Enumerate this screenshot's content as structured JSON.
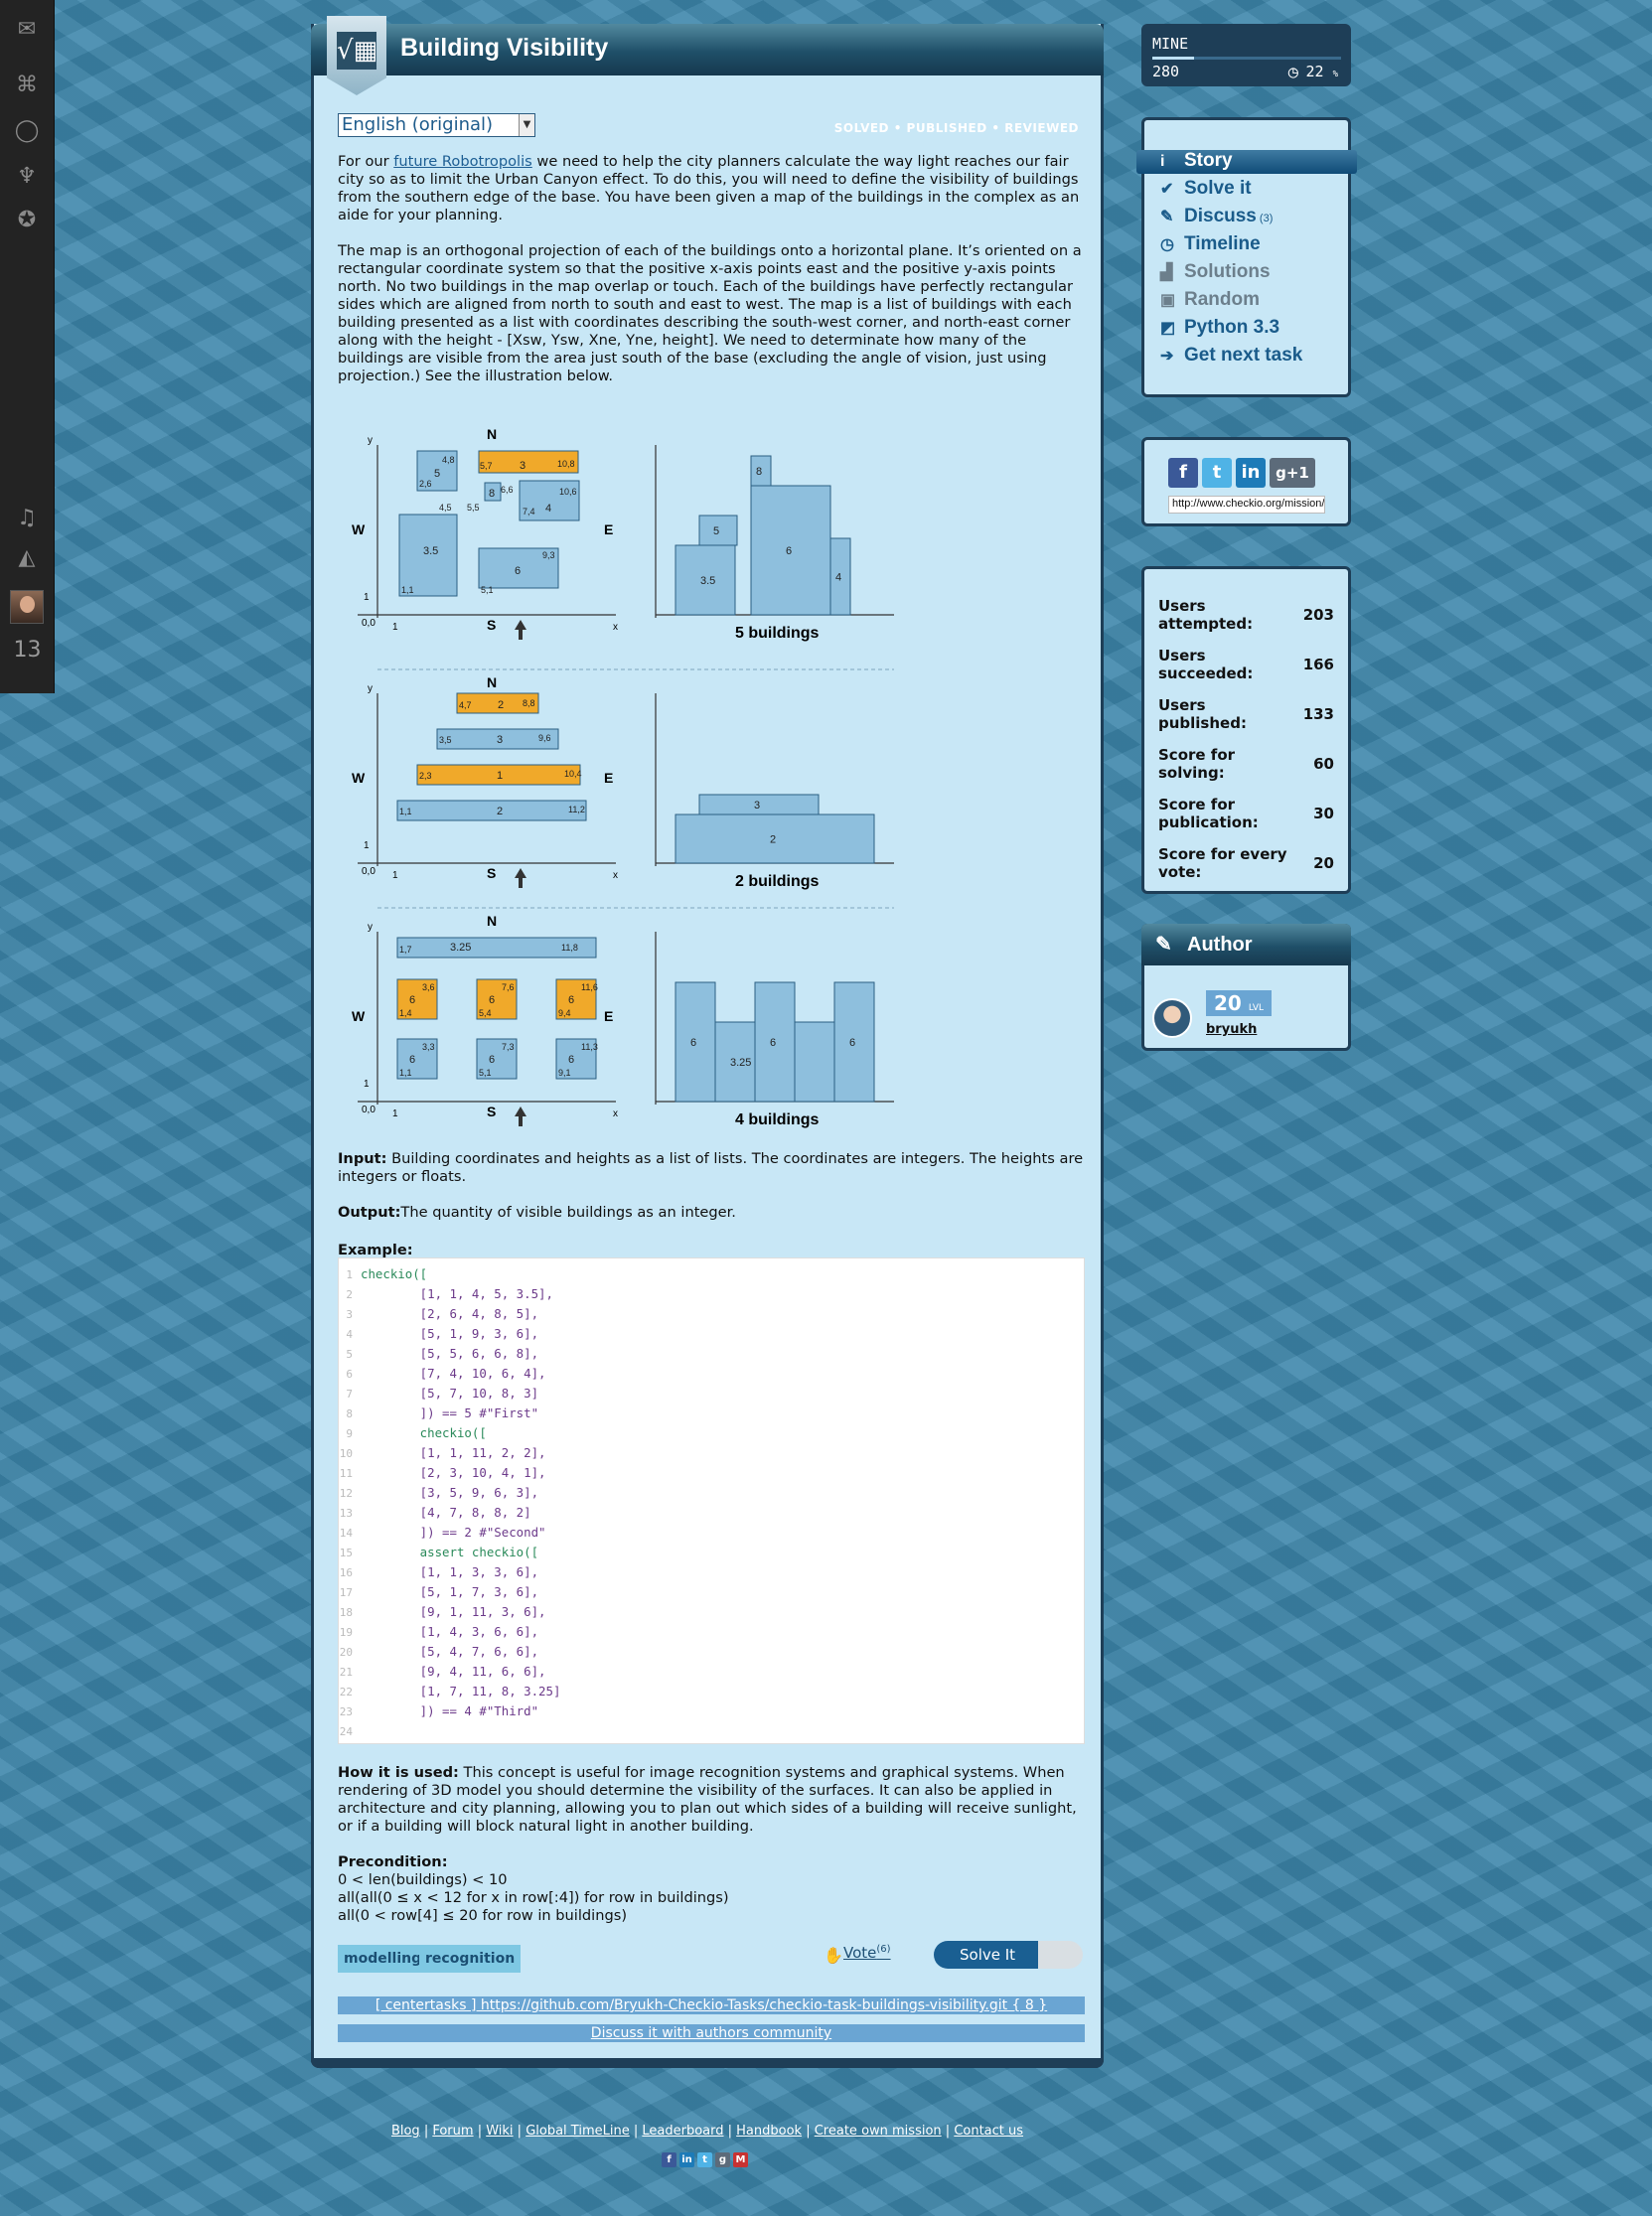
{
  "leftnav": {
    "count": "13"
  },
  "title": "Building Visibility",
  "language": "English (original)",
  "status_flags": "SOLVED • PUBLISHED • REVIEWED",
  "story": {
    "p1_before": "For our ",
    "p1_link": "future Robotropolis",
    "p1_after": " we need to help the city planners calculate the way light reaches our fair city so as to limit the Urban Canyon effect. To do this, you will need to define the visibility of buildings from the southern edge of the base. You have been given a map of the buildings in the complex as an aide for your planning.",
    "p2": "The map is an orthogonal projection of each of the buildings onto a horizontal plane. It’s oriented on a rectangular coordinate system so that the positive x-axis points east and the positive y-axis points north. No two buildings in the map overlap or touch. Each of the buildings have perfectly rectangular sides which are aligned from north to south and east to west. The map is a list of buildings with each building presented as a list with coordinates describing the south-west corner, and north-east corner along with the height - [Xsw, Ysw, Xne, Yne, height]. We need to determinate how many of the buildings are visible from the area just south of the base (excluding the angle of vision, just using projection.) See the illustration below.",
    "input_label": "Input:",
    "input_text": " Building coordinates and heights as a list of lists. The coordinates are integers. The heights are integers or floats.",
    "output_label": "Output:",
    "output_text": "The quantity of visible buildings as an integer.",
    "example_label": "Example:",
    "how_label": "How it is used:",
    "how_text": " This concept is useful for image recognition systems and graphical systems. When rendering of 3D model you should determine the visibility of the surfaces. It can also be applied in architecture and city planning, allowing you to plan out which sides of a building will receive sunlight, or if a building will block natural light in another building.",
    "pre_label": "Precondition:",
    "pre_lines": [
      "0 < len(buildings) < 10",
      "all(all(0 ≤ x < 12 for x in row[:4]) for row in buildings)",
      "all(0 < row[4] ≤ 20 for row in buildings)"
    ]
  },
  "illustration": {
    "compass": {
      "n": "N",
      "s": "S",
      "w": "W",
      "e": "E",
      "x": "x",
      "y": "y",
      "origin": "0,0",
      "one": "1"
    },
    "captions": [
      "5 buildings",
      "2 buildings",
      "4 buildings"
    ],
    "map1": {
      "labels": [
        "4,8",
        "5",
        "2,6",
        "5,7",
        "3",
        "10,8",
        "6,6",
        "8",
        "5,5",
        "4,5",
        "3.5",
        "10,6",
        "4",
        "7,4",
        "9,3",
        "6",
        "5,1",
        "1,1"
      ],
      "front": [
        "3.5",
        "5",
        "8",
        "6",
        "4"
      ]
    },
    "map2": {
      "labels": [
        "4,7",
        "2",
        "8,8",
        "3,5",
        "3",
        "9,6",
        "2,3",
        "1",
        "10,4",
        "1,1",
        "2",
        "11,2"
      ],
      "front": [
        "3",
        "2"
      ]
    },
    "map3": {
      "labels": [
        "1,7",
        "3.25",
        "11,8",
        "3,6",
        "6",
        "1,4",
        "7,6",
        "6",
        "5,4",
        "11,6",
        "6",
        "9,4",
        "3,3",
        "6",
        "1,1",
        "7,3",
        "6",
        "5,1",
        "11,3",
        "6",
        "9,1"
      ],
      "front": [
        "6",
        "3.25",
        "6",
        "6"
      ]
    }
  },
  "code_lines": [
    "checkio([",
    "        [1, 1, 4, 5, 3.5],",
    "        [2, 6, 4, 8, 5],",
    "        [5, 1, 9, 3, 6],",
    "        [5, 5, 6, 6, 8],",
    "        [7, 4, 10, 6, 4],",
    "        [5, 7, 10, 8, 3]",
    "        ]) == 5 #\"First\"",
    "        checkio([",
    "        [1, 1, 11, 2, 2],",
    "        [2, 3, 10, 4, 1],",
    "        [3, 5, 9, 6, 3],",
    "        [4, 7, 8, 8, 2]",
    "        ]) == 2 #\"Second\"",
    "        assert checkio([",
    "        [1, 1, 3, 3, 6],",
    "        [5, 1, 7, 3, 6],",
    "        [9, 1, 11, 3, 6],",
    "        [1, 4, 3, 6, 6],",
    "        [5, 4, 7, 6, 6],",
    "        [9, 4, 11, 6, 6],",
    "        [1, 7, 11, 8, 3.25]",
    "        ]) == 4 #\"Third\"",
    ""
  ],
  "tags": [
    "modelling",
    "recognition"
  ],
  "vote": {
    "label": "Vote",
    "count": "(6)"
  },
  "solve_button": "Solve It",
  "repo_link": "[ centertasks ] https://github.com/Bryukh-Checkio-Tasks/checkio-task-buildings-visibility.git { 8 }",
  "discuss_link": "Discuss it with authors community",
  "mine": {
    "label": "MINE",
    "score": "280",
    "percent": "22",
    "pct_unit": "%",
    "progress": 0.22
  },
  "menu": [
    {
      "label": "Story",
      "icon": "info-icon",
      "glyph": "i"
    },
    {
      "label": "Solve it",
      "icon": "check-icon",
      "glyph": "✔"
    },
    {
      "label": "Discuss",
      "count": "(3)",
      "icon": "chat-icon",
      "glyph": "✎"
    },
    {
      "label": "Timeline",
      "icon": "clock-icon",
      "glyph": "◷"
    },
    {
      "label": "Solutions",
      "icon": "solutions-icon",
      "glyph": "▟"
    },
    {
      "label": "Random",
      "icon": "random-icon",
      "glyph": "▣"
    },
    {
      "label": "Python 3.3",
      "icon": "python-icon",
      "glyph": "◩"
    },
    {
      "label": "Get next task",
      "icon": "arrow-icon",
      "glyph": "➔"
    }
  ],
  "share": {
    "url": "http://www.checkio.org/mission/building-visibility/"
  },
  "stats": [
    {
      "label": "Users attempted:",
      "value": "203"
    },
    {
      "label": "Users succeeded:",
      "value": "166"
    },
    {
      "label": "Users published:",
      "value": "133"
    },
    {
      "label": "Score for solving:",
      "value": "60"
    },
    {
      "label": "Score for publication:",
      "value": "30"
    },
    {
      "label": "Score for every vote:",
      "value": "20"
    }
  ],
  "author": {
    "heading": "Author",
    "level": "20",
    "level_unit": "LVL",
    "name": "bryukh"
  },
  "footer": [
    "Blog",
    "Forum",
    "Wiki",
    "Global TimeLine",
    "Leaderboard",
    "Handbook",
    "Create own mission",
    "Contact us"
  ]
}
